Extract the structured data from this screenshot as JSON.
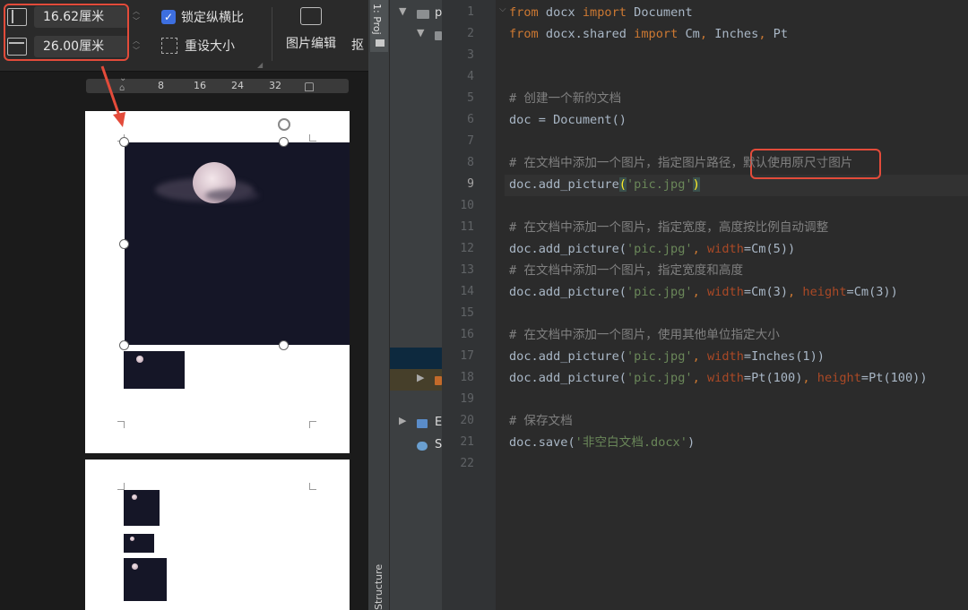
{
  "toolbar": {
    "width_value": "16.62厘米",
    "height_value": "26.00厘米",
    "lock_ratio_label": "锁定纵横比",
    "lock_ratio_checked": true,
    "reset_size_label": "重设大小",
    "edit_picture_label": "图片编辑",
    "cutout_label": "抠"
  },
  "ruler": {
    "labels": [
      "8",
      "16",
      "24",
      "32"
    ]
  },
  "ide": {
    "project_tab": "1: Proj",
    "structure_tab": "Structure",
    "tree": [
      {
        "arrow": "▼",
        "name": "p"
      },
      {
        "arrow": "▼",
        "name": ""
      },
      {
        "arrow": "",
        "name": ""
      },
      {
        "arrow": "▶",
        "name": ""
      },
      {
        "arrow": "▶",
        "name": "E"
      },
      {
        "arrow": "",
        "name": "S"
      }
    ],
    "active_line": "9",
    "lines": [
      {
        "n": "1",
        "tokens": [
          {
            "t": "kw",
            "v": "from"
          },
          {
            "t": "",
            "v": " docx "
          },
          {
            "t": "kw",
            "v": "import"
          },
          {
            "t": "",
            "v": " Document"
          }
        ]
      },
      {
        "n": "2",
        "tokens": [
          {
            "t": "kw",
            "v": "from"
          },
          {
            "t": "",
            "v": " docx.shared "
          },
          {
            "t": "kw",
            "v": "import"
          },
          {
            "t": "",
            "v": " Cm"
          },
          {
            "t": "kw",
            "v": ","
          },
          {
            "t": "",
            "v": " Inches"
          },
          {
            "t": "kw",
            "v": ","
          },
          {
            "t": "",
            "v": " Pt"
          }
        ]
      },
      {
        "n": "3",
        "tokens": []
      },
      {
        "n": "4",
        "tokens": []
      },
      {
        "n": "5",
        "tokens": [
          {
            "t": "cm",
            "v": "# 创建一个新的文档"
          }
        ]
      },
      {
        "n": "6",
        "tokens": [
          {
            "t": "",
            "v": "doc = Document()"
          }
        ]
      },
      {
        "n": "7",
        "tokens": []
      },
      {
        "n": "8",
        "tokens": [
          {
            "t": "cm",
            "v": "# 在文档中添加一个图片，指定图片路径，默认使用原尺寸图片"
          }
        ]
      },
      {
        "n": "9",
        "tokens": [
          {
            "t": "",
            "v": "doc.add_picture"
          },
          {
            "t": "br",
            "v": "("
          },
          {
            "t": "st",
            "v": "'pic.jpg'"
          },
          {
            "t": "br",
            "v": ")"
          }
        ]
      },
      {
        "n": "10",
        "tokens": []
      },
      {
        "n": "11",
        "tokens": [
          {
            "t": "cm",
            "v": "# 在文档中添加一个图片，指定宽度，高度按比例自动调整"
          }
        ]
      },
      {
        "n": "12",
        "tokens": [
          {
            "t": "",
            "v": "doc.add_picture("
          },
          {
            "t": "st",
            "v": "'pic.jpg'"
          },
          {
            "t": "kw",
            "v": ", "
          },
          {
            "t": "pn",
            "v": "width"
          },
          {
            "t": "",
            "v": "=Cm(5))"
          }
        ]
      },
      {
        "n": "13",
        "tokens": [
          {
            "t": "cm",
            "v": "# 在文档中添加一个图片，指定宽度和高度"
          }
        ]
      },
      {
        "n": "14",
        "tokens": [
          {
            "t": "",
            "v": "doc.add_picture("
          },
          {
            "t": "st",
            "v": "'pic.jpg'"
          },
          {
            "t": "kw",
            "v": ", "
          },
          {
            "t": "pn",
            "v": "width"
          },
          {
            "t": "",
            "v": "=Cm(3)"
          },
          {
            "t": "kw",
            "v": ", "
          },
          {
            "t": "pn",
            "v": "height"
          },
          {
            "t": "",
            "v": "=Cm(3))"
          }
        ]
      },
      {
        "n": "15",
        "tokens": []
      },
      {
        "n": "16",
        "tokens": [
          {
            "t": "cm",
            "v": "# 在文档中添加一个图片，使用其他单位指定大小"
          }
        ]
      },
      {
        "n": "17",
        "tokens": [
          {
            "t": "",
            "v": "doc.add_picture("
          },
          {
            "t": "st",
            "v": "'pic.jpg'"
          },
          {
            "t": "kw",
            "v": ", "
          },
          {
            "t": "pn",
            "v": "width"
          },
          {
            "t": "",
            "v": "=Inches(1))"
          }
        ]
      },
      {
        "n": "18",
        "tokens": [
          {
            "t": "",
            "v": "doc.add_picture("
          },
          {
            "t": "st",
            "v": "'pic.jpg'"
          },
          {
            "t": "kw",
            "v": ", "
          },
          {
            "t": "pn",
            "v": "width"
          },
          {
            "t": "",
            "v": "=Pt(100)"
          },
          {
            "t": "kw",
            "v": ", "
          },
          {
            "t": "pn",
            "v": "height"
          },
          {
            "t": "",
            "v": "=Pt(100))"
          }
        ]
      },
      {
        "n": "19",
        "tokens": []
      },
      {
        "n": "20",
        "tokens": [
          {
            "t": "cm",
            "v": "# 保存文档"
          }
        ]
      },
      {
        "n": "21",
        "tokens": [
          {
            "t": "",
            "v": "doc.save("
          },
          {
            "t": "st",
            "v": "'非空白文档.docx'"
          },
          {
            "t": "",
            "v": ")"
          }
        ]
      },
      {
        "n": "22",
        "tokens": []
      }
    ]
  },
  "colors": {
    "highlight_red": "#e34b3a",
    "keyword": "#cc7832",
    "comment": "#808080",
    "string": "#6a8759",
    "param": "#aa4926",
    "checkbox_blue": "#3d6fe0"
  }
}
